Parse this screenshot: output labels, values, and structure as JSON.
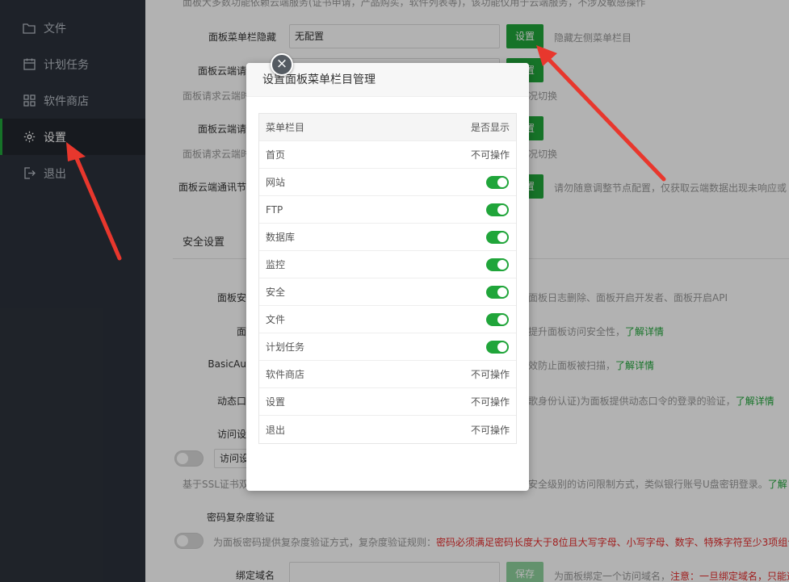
{
  "sidebar": {
    "items": [
      {
        "label": "文件",
        "icon": "folder-icon",
        "active": false
      },
      {
        "label": "计划任务",
        "icon": "calendar-icon",
        "active": false
      },
      {
        "label": "软件商店",
        "icon": "grid-icon",
        "active": false
      },
      {
        "label": "设置",
        "icon": "gear-icon",
        "active": true
      },
      {
        "label": "退出",
        "icon": "logout-icon",
        "active": false
      }
    ]
  },
  "settings": {
    "top_note": "面板大多数功能依赖云端服务(证书申请，产品购买，软件列表等)，该功能仅用于云端服务，不涉及敏感操作",
    "menu_hide": {
      "label": "面板菜单栏隐藏",
      "value": "无配置",
      "button": "设置",
      "hint": "隐藏左侧菜单栏目"
    },
    "cloud_req1": {
      "label": "面板云端请",
      "button": "设置",
      "note_left": "面板请求云端时",
      "note_right": "况切换"
    },
    "cloud_req2": {
      "label": "面板云端请",
      "button": "设置",
      "note_left": "面板请求云端时",
      "note_right": "况切换"
    },
    "cloud_node": {
      "label": "面板云端通讯节",
      "button": "设置",
      "hint": "请勿随意调整节点配置，仅获取云端数据出现未响应或"
    },
    "security_title": "安全设置",
    "panel_sec": {
      "label": "面板安",
      "hint": "面板日志删除、面板开启开发者、面板开启API"
    },
    "panel_x": {
      "label": "面",
      "hint": "提升面板访问安全性，",
      "link": "了解详情"
    },
    "basic_auth": {
      "label": "BasicAu",
      "hint": "效防止面板被扫描，",
      "link": "了解详情"
    },
    "dynamic": {
      "label": "动态口",
      "hint": "歌身份认证)为面板提供动态口令的登录的验证，",
      "link": "了解详情"
    },
    "access": {
      "label": "访问设",
      "select": "访问设",
      "note_left": "基于SSL证书双",
      "note_right": "安全级别的访问限制方式，类似银行账号U盘密钥登录。",
      "link": "了解"
    },
    "pwd": {
      "label": "密码复杂度验证",
      "hint": "为面板密码提供复杂度验证方式，复杂度验证规则：",
      "rule": "密码必须满足密码长度大于8位且大写字母、小写字母、数字、特殊字符至少3项组合"
    },
    "domain": {
      "label": "绑定域名",
      "button": "保存",
      "hint": "为面板绑定一个访问域名，",
      "warn": "注意：一旦绑定域名，只能通"
    }
  },
  "modal": {
    "title": "设置面板菜单栏目管理",
    "close": "×",
    "header": {
      "col1": "菜单栏目",
      "col2": "是否显示"
    },
    "rows": [
      {
        "name": "首页",
        "state": "不可操作"
      },
      {
        "name": "网站",
        "state": "on"
      },
      {
        "name": "FTP",
        "state": "on"
      },
      {
        "name": "数据库",
        "state": "on"
      },
      {
        "name": "监控",
        "state": "on"
      },
      {
        "name": "安全",
        "state": "on"
      },
      {
        "name": "文件",
        "state": "on"
      },
      {
        "name": "计划任务",
        "state": "on"
      },
      {
        "name": "软件商店",
        "state": "不可操作"
      },
      {
        "name": "设置",
        "state": "不可操作"
      },
      {
        "name": "退出",
        "state": "不可操作"
      }
    ]
  },
  "colors": {
    "accent": "#20a53a",
    "sidebar": "#2c323b",
    "arrow": "#e8372d",
    "warn": "#e62c2c"
  }
}
